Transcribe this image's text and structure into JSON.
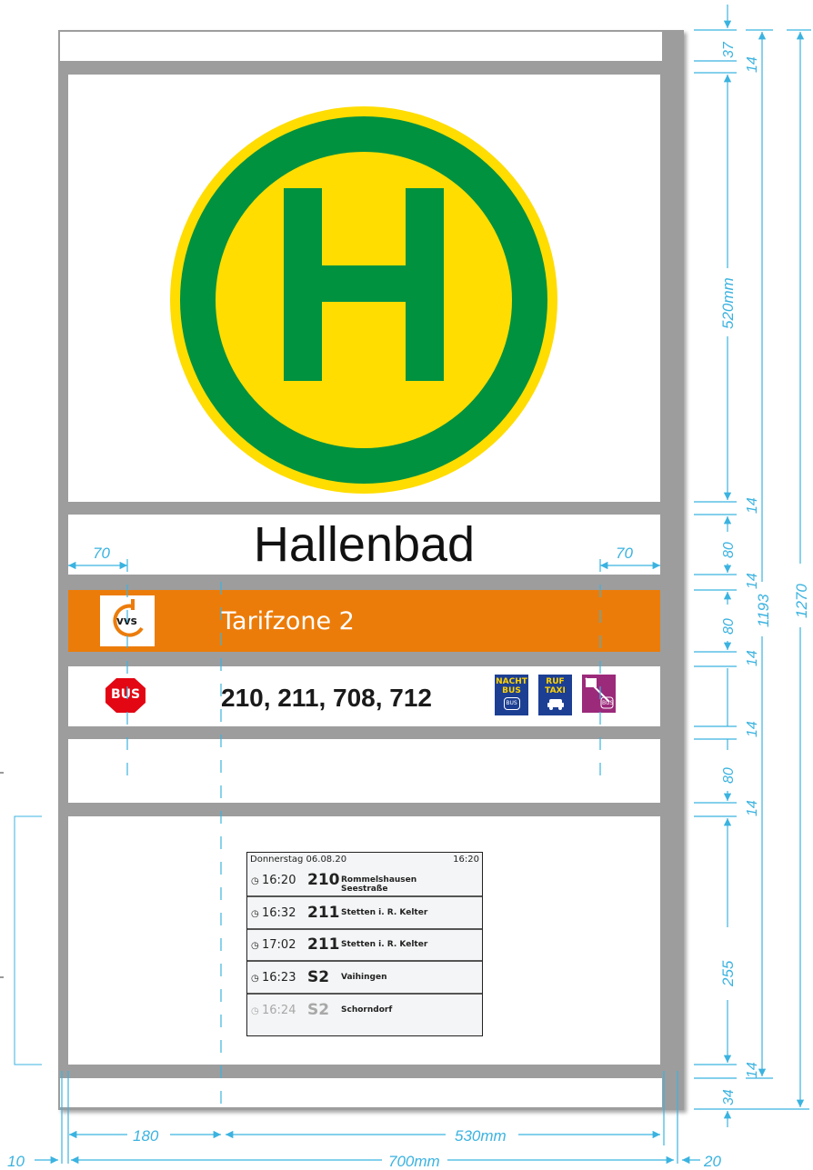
{
  "sign": {
    "stop_name": "Hallenbad",
    "zone_label": "Tarifzone 2",
    "lines": "210, 211, 708, 712",
    "vvs_logo_text": "vvs",
    "bus_badge": "BUS",
    "service_badges": [
      {
        "line1": "NACHT",
        "line2": "BUS",
        "sub": "BUS"
      },
      {
        "line1": "RUF",
        "line2": "TAXI",
        "sub": ""
      },
      {
        "line1": "",
        "line2": "",
        "sub": "BUS"
      }
    ]
  },
  "departure_screen": {
    "date": "Donnerstag 06.08.20",
    "time": "16:20",
    "rows": [
      {
        "time": "16:20",
        "line": "210",
        "dest1": "Rommelshausen",
        "dest2": "Seestraße"
      },
      {
        "time": "16:32",
        "line": "211",
        "dest1": "Stetten i. R. Kelter",
        "dest2": ""
      },
      {
        "time": "17:02",
        "line": "211",
        "dest1": "Stetten i. R. Kelter",
        "dest2": ""
      },
      {
        "time": "16:23",
        "line": "S2",
        "dest1": "Vaihingen",
        "dest2": ""
      },
      {
        "time": "16:24",
        "line": "S2",
        "dest1": "Schorndorf",
        "dest2": ""
      }
    ]
  },
  "dimensions": {
    "left_margin": "70",
    "right_margin": "70",
    "bottom_left_offset": "10",
    "bottom_left_width": "180",
    "bottom_right_width": "530mm",
    "bottom_total": "700mm",
    "bottom_right_offset": "20",
    "right_top": "37",
    "right_gap1": "14",
    "right_logo": "520mm",
    "right_gap2": "14",
    "right_name": "80",
    "right_gap3": "14",
    "right_zone": "80",
    "right_gap4": "14",
    "right_gap5": "14",
    "right_empty": "80",
    "right_gap6": "14",
    "right_screen": "255",
    "right_gap7": "14",
    "right_bottom": "34",
    "inner_height": "1193",
    "total_height": "1270"
  },
  "colors": {
    "frame": "#9d9d9d",
    "green": "#00923f",
    "yellow": "#ffdd00",
    "orange": "#ec7c0a",
    "bus_red": "#e30613",
    "dimension_blue": "#3bb3e0"
  }
}
